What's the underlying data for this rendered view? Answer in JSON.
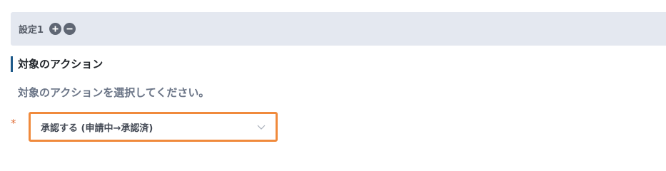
{
  "setting": {
    "label": "設定1",
    "add_icon": "plus-circle-icon",
    "remove_icon": "minus-circle-icon"
  },
  "section": {
    "title": "対象のアクション",
    "description": "対象のアクションを選択してください。"
  },
  "field": {
    "required_mark": "*",
    "selected_value": "承認する (申請中→承認済)",
    "dropdown_icon": "chevron-down-icon"
  },
  "colors": {
    "accent_bar": "#1e5a8a",
    "focus_border": "#f08a3c",
    "required": "#e0703a",
    "header_bg": "#e4e8f0"
  }
}
